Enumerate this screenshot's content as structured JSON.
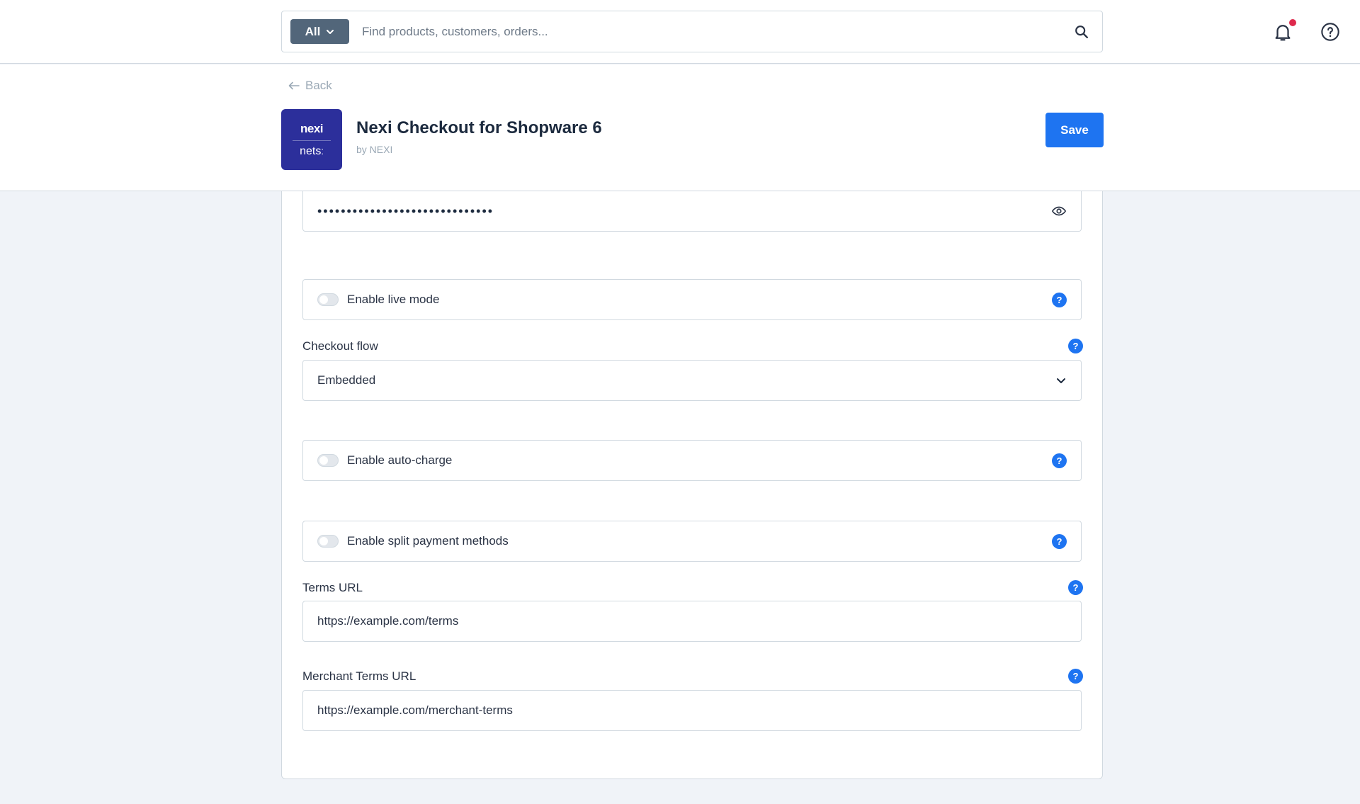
{
  "search": {
    "type_label": "All",
    "placeholder": "Find products, customers, orders..."
  },
  "header": {
    "back_label": "Back",
    "logo_top": "nexi",
    "logo_bottom": "nets",
    "title": "Nexi Checkout for Shopware 6",
    "vendor": "by NEXI",
    "save_label": "Save"
  },
  "form": {
    "password_mask": "••••••••••••••••••••••••••••••",
    "live_mode_label": "Enable live mode",
    "checkout_flow_label": "Checkout flow",
    "checkout_flow_value": "Embedded",
    "auto_charge_label": "Enable auto-charge",
    "split_payment_label": "Enable split payment methods",
    "terms_url_label": "Terms URL",
    "terms_url_value": "https://example.com/terms",
    "merchant_terms_url_label": "Merchant Terms URL",
    "merchant_terms_url_value": "https://example.com/merchant-terms",
    "help_glyph": "?"
  },
  "colors": {
    "primary": "#1e74f1",
    "logo_bg": "#2c2f9b",
    "notification_dot": "#de294c"
  }
}
